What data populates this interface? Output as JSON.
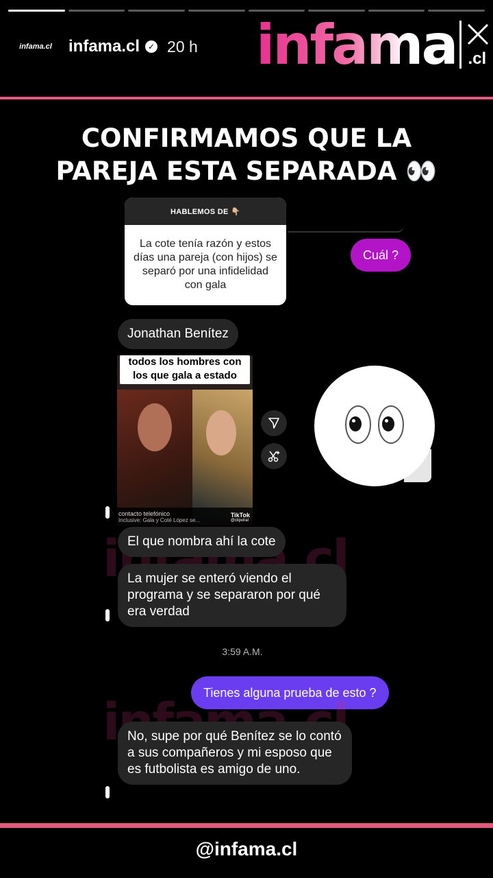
{
  "story": {
    "segments_total": 8,
    "segment_active": 1,
    "account": "infama.cl",
    "avatar_text": "infama.cl",
    "time_ago": "20 h"
  },
  "brand": {
    "logo_text": "infama",
    "logo_suffix": ".cl",
    "accent": "#e25a7c"
  },
  "headline": {
    "line1": "CONFIRMAMOS QUE LA",
    "line2": "PAREJA ESTA SEPARADA 👀"
  },
  "question_box": {
    "header": "HABLEMOS DE 👇🏼",
    "body": "La cote tenía razón y estos días una pareja (con hijos) se separó por una infidelidad con gala"
  },
  "chat": {
    "out_1": "Cuál ?",
    "in_1": "Jonathan Benítez",
    "video_caption": "todos los hombres con los que gala a estado",
    "video_footer": "contacto telefónico",
    "video_footer2": "Inclusive: Gala y Coté López se...",
    "tiktok": "TikTok",
    "tiktok_handle": "@clipviral",
    "in_2": "El que nombra ahí la cote",
    "in_3": "La mujer se enteró viendo el programa y se separaron por qué era verdad",
    "timestamp": "3:59 A.M.",
    "out_2": "Tienes alguna prueba de esto ?",
    "in_4": "No, supe por qué Benítez se lo contó a sus compañeros y mi esposo que es futbolista es amigo de uno.",
    "reaction": "👀"
  },
  "footer": {
    "handle": "@infama.cl"
  },
  "colors": {
    "out_bubble_1": "#b414c8",
    "out_bubble_2": "#6b3df0",
    "in_bubble": "#262626"
  }
}
